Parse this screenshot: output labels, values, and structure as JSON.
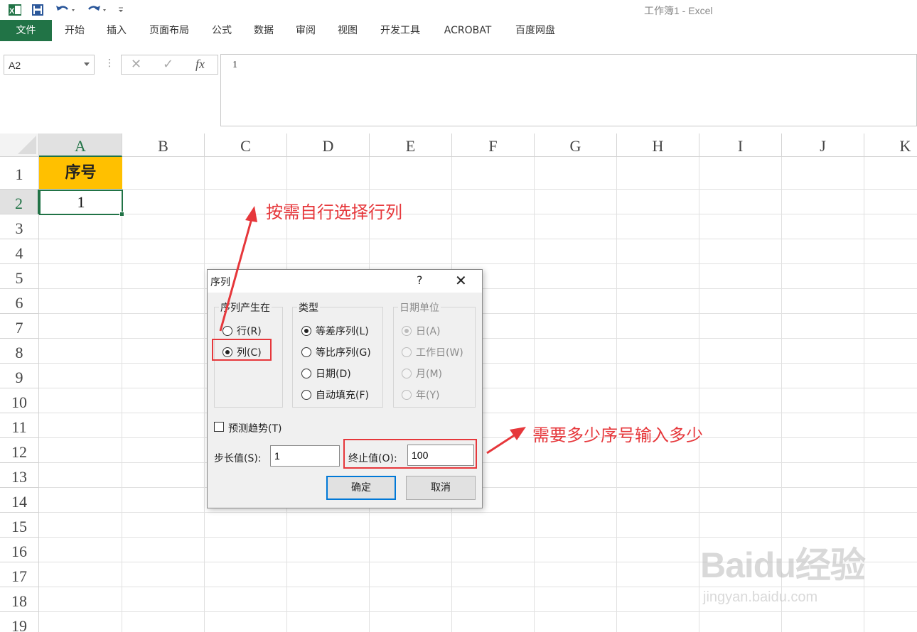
{
  "app": {
    "title": "工作簿1 - Excel",
    "accent_color": "#217346"
  },
  "qat": {
    "excel_icon": "excel-icon",
    "save_icon": "save-icon",
    "undo_icon": "undo-icon",
    "redo_icon": "redo-icon",
    "customize_icon": "customize-qat-icon"
  },
  "ribbon": {
    "tabs": [
      "文件",
      "开始",
      "插入",
      "页面布局",
      "公式",
      "数据",
      "审阅",
      "视图",
      "开发工具",
      "ACROBAT",
      "百度网盘"
    ]
  },
  "formula_bar": {
    "name_box": "A2",
    "cancel_glyph": "✕",
    "enter_glyph": "✓",
    "fx_label": "fx",
    "value": "1"
  },
  "sheet": {
    "columns": [
      "A",
      "B",
      "C",
      "D",
      "E",
      "F",
      "G",
      "H",
      "I",
      "J",
      "K"
    ],
    "rows": [
      "1",
      "2",
      "3",
      "4",
      "5",
      "6",
      "7",
      "8",
      "9",
      "10",
      "11",
      "12",
      "13",
      "14",
      "15",
      "16",
      "17",
      "18",
      "19"
    ],
    "selected_column": "A",
    "selected_row": "2",
    "cell_a1": "序号",
    "cell_a2": "1",
    "header_fill_color": "#ffc000"
  },
  "dialog": {
    "title": "序列",
    "help": "?",
    "close": "✕",
    "series_in": {
      "title": "序列产生在",
      "options": [
        "行(R)",
        "列(C)"
      ],
      "selected": "列(C)"
    },
    "type": {
      "title": "类型",
      "options": [
        "等差序列(L)",
        "等比序列(G)",
        "日期(D)",
        "自动填充(F)"
      ],
      "selected": "等差序列(L)"
    },
    "date_unit": {
      "title": "日期单位",
      "options": [
        "日(A)",
        "工作日(W)",
        "月(M)",
        "年(Y)"
      ],
      "selected": "日(A)",
      "disabled": true
    },
    "trend_label": "预测趋势(T)",
    "trend_checked": false,
    "step_label": "步长值(S):",
    "step_value": "1",
    "stop_label": "终止值(O):",
    "stop_value": "100",
    "ok_label": "确定",
    "cancel_label": "取消"
  },
  "annotations": {
    "choose_row_col": "按需自行选择行列",
    "how_many": "需要多少序号输入多少",
    "color": "#e6373b"
  },
  "watermark": {
    "logo": "Baidu经验",
    "url": "jingyan.baidu.com"
  }
}
